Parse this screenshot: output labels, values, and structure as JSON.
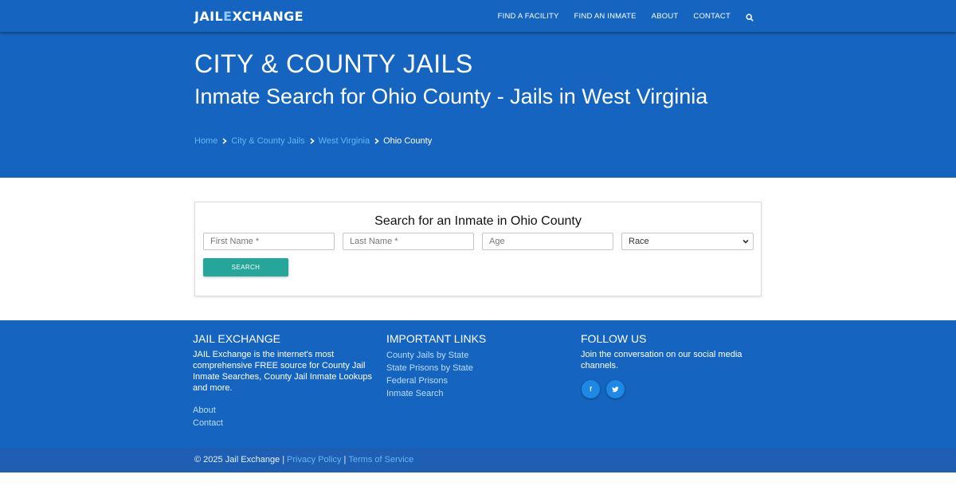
{
  "header": {
    "logo_part1": "JAIL",
    "logo_part2": "E",
    "logo_part3": "XCHANGE",
    "nav": [
      "FIND A FACILITY",
      "FIND AN INMATE",
      "ABOUT",
      "CONTACT"
    ],
    "search_icon": "search-icon"
  },
  "hero": {
    "title": "CITY & COUNTY JAILS",
    "subtitle": "Inmate Search for Ohio County - Jails in West Virginia",
    "breadcrumb": [
      "Home",
      "City & County Jails",
      "West Virginia"
    ],
    "breadcrumb_current": "Ohio County"
  },
  "search_form": {
    "heading": "Search for an Inmate in Ohio County",
    "first_name_placeholder": "First Name *",
    "last_name_placeholder": "Last Name *",
    "age_placeholder": "Age",
    "race_selected": "Race",
    "submit_label": "SEARCH"
  },
  "footer": {
    "about": {
      "title": "JAIL EXCHANGE",
      "text": "JAIL Exchange is the internet's most comprehensive FREE source for County Jail Inmate Searches, County Jail Inmate Lookups and more.",
      "links": [
        "About",
        "Contact"
      ]
    },
    "important": {
      "title": "IMPORTANT LINKS",
      "links": [
        "County Jails by State",
        "State Prisons by State",
        "Federal Prisons",
        "Inmate Search"
      ]
    },
    "follow": {
      "title": "FOLLOW US",
      "text": "Join the conversation on our social media channels.",
      "facebook_glyph": "f",
      "twitter_glyph": "✔"
    }
  },
  "bottom_bar": {
    "copyright": "© 2025 Jail Exchange",
    "separator": "|",
    "privacy": "Privacy Policy",
    "terms": "Terms of Service"
  },
  "colors": {
    "primary_blue": "#1565c0",
    "link_blue": "#64b5f6",
    "teal_button": "#26a69a"
  }
}
